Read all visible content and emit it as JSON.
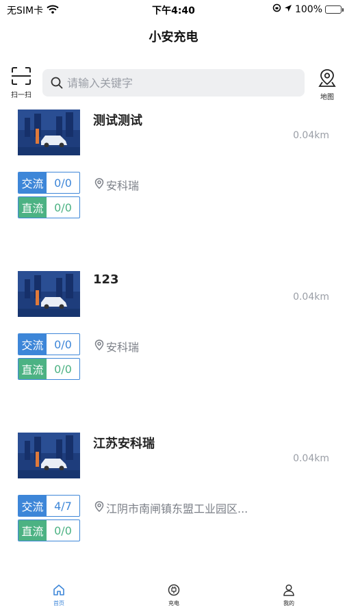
{
  "status_bar": {
    "carrier": "无SIM卡",
    "time": "下午4:40",
    "battery": "100%"
  },
  "header": {
    "title": "小安充电"
  },
  "toolbar": {
    "scan_label": "扫一扫",
    "search_placeholder": "请输入关键字",
    "map_label": "地图"
  },
  "stations": [
    {
      "name": "测试测试",
      "distance": "0.04km",
      "ac_label": "交流",
      "ac_count": "0/0",
      "dc_label": "直流",
      "dc_count": "0/0",
      "address": "安科瑞"
    },
    {
      "name": "123",
      "distance": "0.04km",
      "ac_label": "交流",
      "ac_count": "0/0",
      "dc_label": "直流",
      "dc_count": "0/0",
      "address": "安科瑞"
    },
    {
      "name": "江苏安科瑞",
      "distance": "0.04km",
      "ac_label": "交流",
      "ac_count": "4/7",
      "dc_label": "直流",
      "dc_count": "0/0",
      "address": "江阴市南闸镇东盟工业园区..."
    }
  ],
  "tabbar": {
    "items": [
      {
        "label": "首页",
        "icon": "home-icon",
        "active": true
      },
      {
        "label": "充电",
        "icon": "charge-icon",
        "active": false
      },
      {
        "label": "我的",
        "icon": "person-icon",
        "active": false
      }
    ]
  },
  "colors": {
    "accent": "#3d86d8",
    "dc_green": "#4cb283",
    "search_bg": "#eeeff1",
    "muted": "#9a9ea6"
  }
}
